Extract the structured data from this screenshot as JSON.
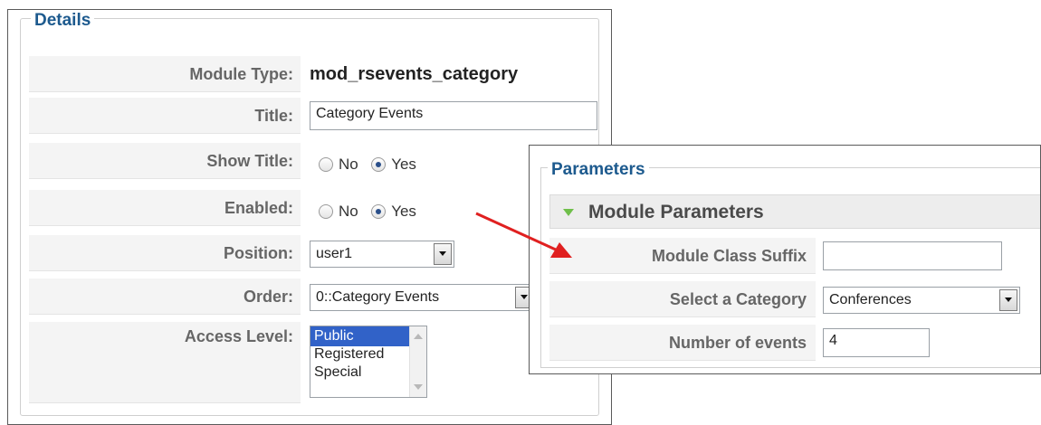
{
  "details": {
    "legend": "Details",
    "module_type": {
      "label": "Module Type:",
      "value": "mod_rsevents_category"
    },
    "title": {
      "label": "Title:",
      "value": "Category Events"
    },
    "show_title": {
      "label": "Show Title:",
      "no": "No",
      "yes": "Yes",
      "selected": "Yes"
    },
    "enabled": {
      "label": "Enabled:",
      "no": "No",
      "yes": "Yes",
      "selected": "Yes"
    },
    "position": {
      "label": "Position:",
      "value": "user1"
    },
    "order": {
      "label": "Order:",
      "value": "0::Category Events"
    },
    "access_level": {
      "label": "Access Level:",
      "options": [
        "Public",
        "Registered",
        "Special"
      ],
      "selected": "Public"
    }
  },
  "parameters": {
    "legend": "Parameters",
    "section_title": "Module Parameters",
    "module_class_suffix": {
      "label": "Module Class Suffix",
      "value": ""
    },
    "select_category": {
      "label": "Select a Category",
      "value": "Conferences"
    },
    "number_of_events": {
      "label": "Number of events",
      "value": "4"
    }
  },
  "colors": {
    "legend": "#1d5a8e",
    "arrow": "#e02020",
    "selected_option": "#3162c8",
    "expand_triangle": "#6fbf4a"
  },
  "icons": [
    "dropdown-arrow-icon",
    "expand-triangle-icon",
    "annotation-arrow-icon"
  ]
}
